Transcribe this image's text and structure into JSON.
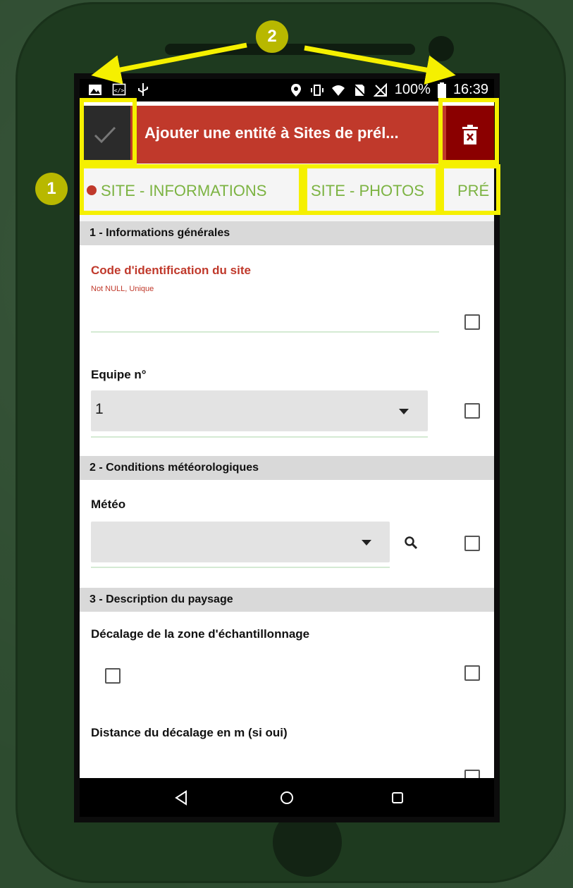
{
  "status_bar": {
    "battery": "100%",
    "time": "16:39"
  },
  "app_bar": {
    "title": "Ajouter une entité à Sites de prél..."
  },
  "tabs": [
    {
      "label": "SITE - INFORMATIONS",
      "active": true
    },
    {
      "label": "SITE - PHOTOS",
      "active": false
    },
    {
      "label": "PRÉ",
      "active": false
    }
  ],
  "sections": [
    {
      "title": "1 - Informations générales"
    },
    {
      "title": "2 - Conditions météorologiques"
    },
    {
      "title": "3 - Description du paysage"
    }
  ],
  "fields": {
    "code": {
      "label": "Code d'identification du site",
      "hint": "Not NULL, Unique",
      "value": ""
    },
    "equipe": {
      "label": "Equipe n°",
      "value": "1"
    },
    "meteo": {
      "label": "Météo",
      "value": ""
    },
    "decalage": {
      "label": "Décalage de la zone d'échantillonnage"
    },
    "distance": {
      "label": "Distance du décalage en m (si oui)"
    }
  },
  "annotations": {
    "badge_1": "1",
    "badge_2": "2",
    "highlight_color": "#f5f000"
  },
  "colors": {
    "app_bar": "#c0392b",
    "delete_bg": "#8b0000",
    "tab_text": "#7cb342",
    "required_label": "#c0392b"
  }
}
